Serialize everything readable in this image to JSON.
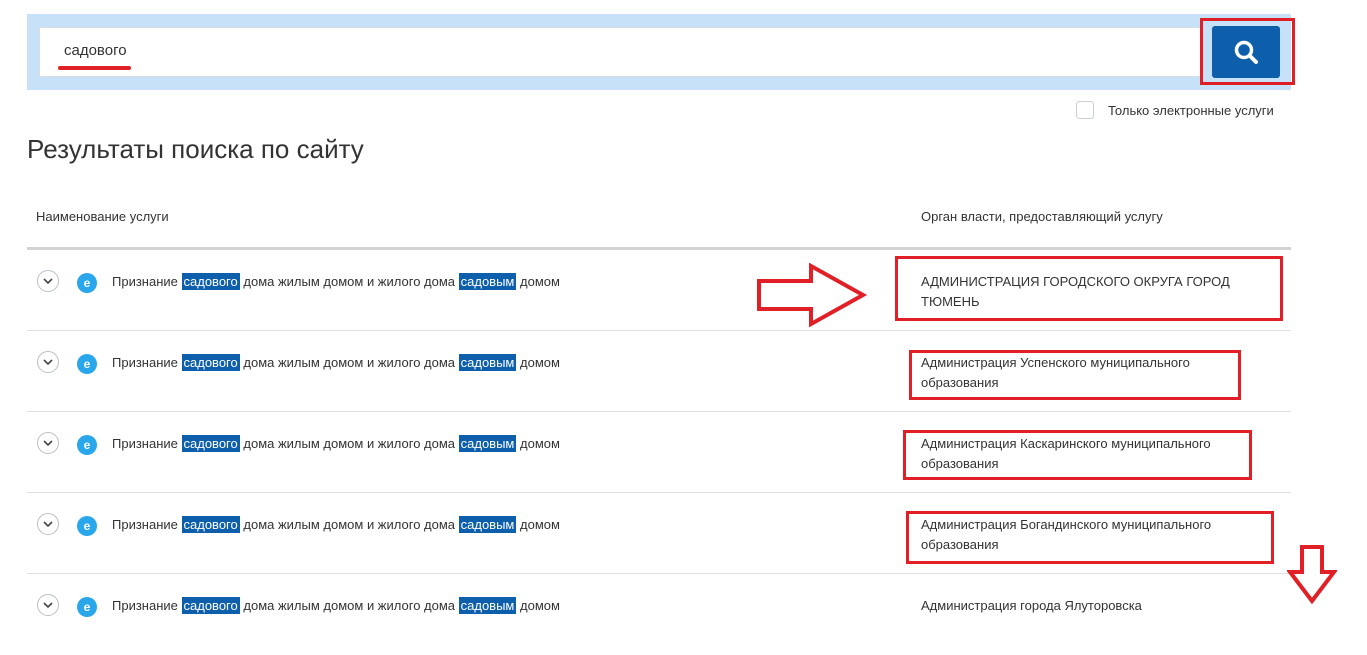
{
  "search": {
    "query": "садового",
    "button_icon": "search-icon"
  },
  "filter": {
    "only_electronic_label": "Только электронные услуги",
    "checked": false
  },
  "page_title": "Результаты поиска по сайту",
  "table": {
    "col_service": "Наименование услуги",
    "col_authority": "Орган власти, предоставляющий услугу",
    "rows": [
      {
        "badge": "e",
        "name_prefix": "Признание",
        "name_hl1": "садового",
        "name_mid": "дома жилым домом и жилого дома",
        "name_hl2": "садовым",
        "name_suffix": "домом",
        "authority": "АДМИНИСТРАЦИЯ ГОРОДСКОГО ОКРУГА ГОРОД ТЮМЕНЬ"
      },
      {
        "badge": "e",
        "name_prefix": "Признание",
        "name_hl1": "садового",
        "name_mid": "дома жилым домом и жилого дома",
        "name_hl2": "садовым",
        "name_suffix": "домом",
        "authority": "Администрация Успенского муниципального образования"
      },
      {
        "badge": "e",
        "name_prefix": "Признание",
        "name_hl1": "садового",
        "name_mid": "дома жилым домом и жилого дома",
        "name_hl2": "садовым",
        "name_suffix": "домом",
        "authority": "Администрация Каскаринского муниципального образования"
      },
      {
        "badge": "e",
        "name_prefix": "Признание",
        "name_hl1": "садового",
        "name_mid": "дома жилым домом и жилого дома",
        "name_hl2": "садовым",
        "name_suffix": "домом",
        "authority": "Администрация Богандинского муниципального образования"
      },
      {
        "badge": "e",
        "name_prefix": "Признание",
        "name_hl1": "садового",
        "name_mid": "дома жилым домом и жилого дома",
        "name_hl2": "садовым",
        "name_suffix": "домом",
        "authority": "Администрация города Ялуторовска"
      }
    ]
  },
  "colors": {
    "accent": "#0e5fab",
    "annotation": "#e01f26",
    "search_band": "#c7e2f8",
    "badge": "#2aa7ea"
  }
}
